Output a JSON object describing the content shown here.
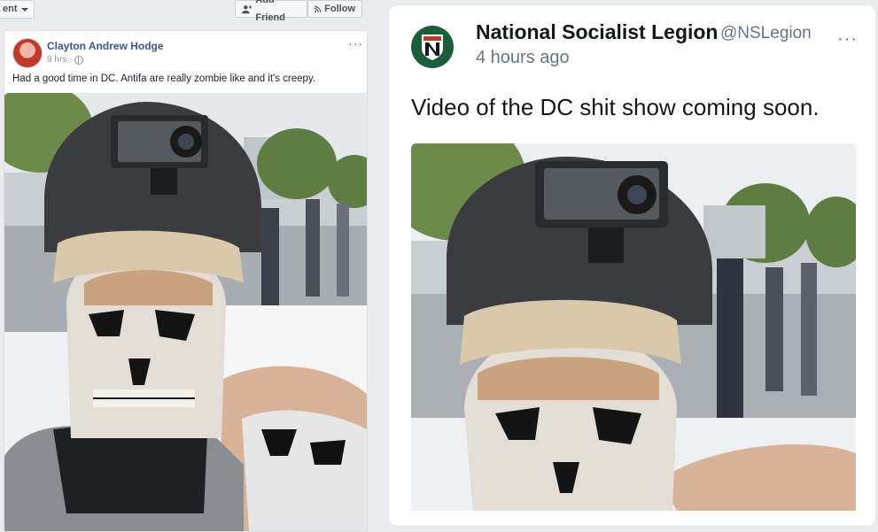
{
  "facebook": {
    "dropdown_label": "ent",
    "add_friend_label": "Add Friend",
    "follow_label": "Follow",
    "post": {
      "author": "Clayton Andrew Hodge",
      "time": "9 hrs ·",
      "more": "···",
      "text": "Had a good time in DC. Antifa are really zombie like and it's creepy."
    }
  },
  "tweet": {
    "display_name": "National Socialist Legion",
    "handle": "@NSLegion",
    "time": "4 hours ago",
    "more": "···",
    "text": "Video of the DC shit show coming soon."
  }
}
